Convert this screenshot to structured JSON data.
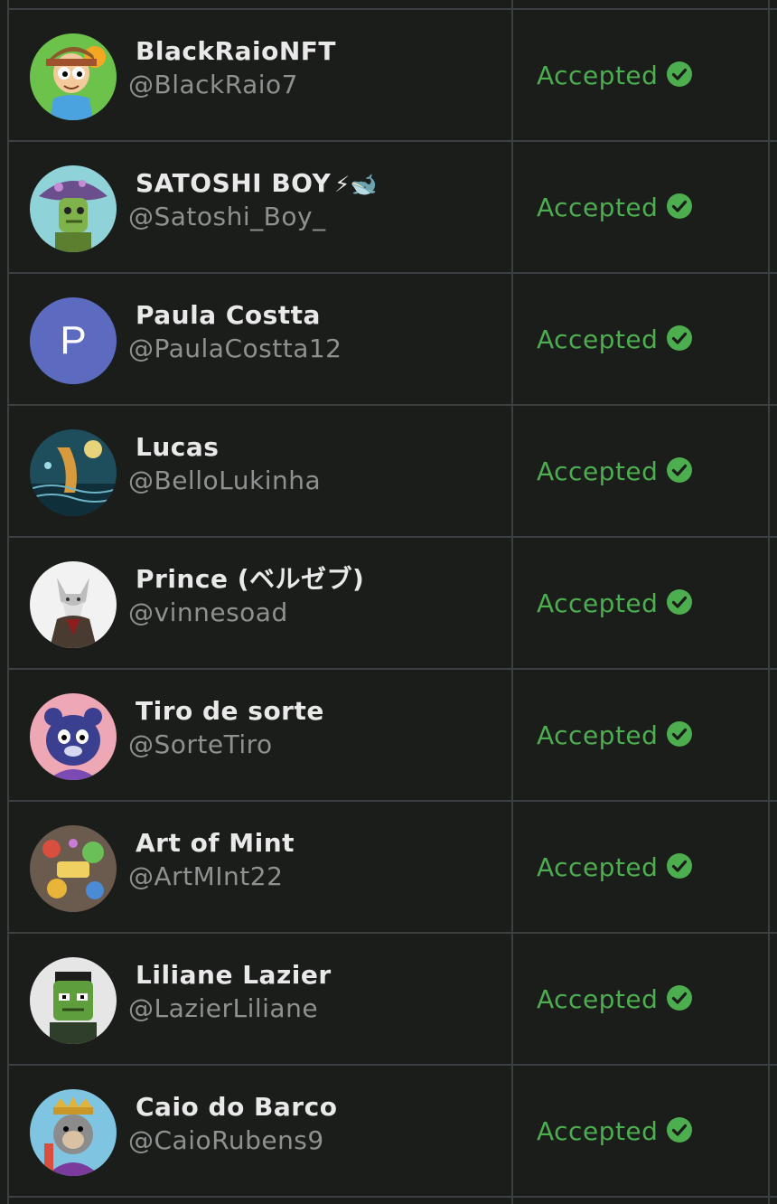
{
  "rows": [
    {
      "name": "BlackRaioNFT",
      "handle": "@BlackRaio7",
      "status": "Accepted",
      "avatar": "cartoon-boy-avatar"
    },
    {
      "name": "SATOSHI BOY",
      "name_suffix": "⚡🐋",
      "handle": "@Satoshi_Boy_",
      "status": "Accepted",
      "avatar": "mushroom-creature-avatar"
    },
    {
      "name": "Paula Costta",
      "handle": "@PaulaCostta12",
      "status": "Accepted",
      "avatar": "letter-avatar",
      "initial": "P"
    },
    {
      "name": "Lucas",
      "handle": "@BelloLukinha",
      "status": "Accepted",
      "avatar": "ocean-art-avatar"
    },
    {
      "name": "Prince (ベルゼブ)",
      "handle": "@vinnesoad",
      "status": "Accepted",
      "avatar": "wolf-avatar"
    },
    {
      "name": "Tiro de sorte",
      "handle": "@SorteTiro",
      "status": "Accepted",
      "avatar": "purple-bear-avatar"
    },
    {
      "name": "Art of Mint",
      "handle": "@ArtMInt22",
      "status": "Accepted",
      "avatar": "art-collage-avatar"
    },
    {
      "name": "Liliane Lazier",
      "handle": "@LazierLiliane",
      "status": "Accepted",
      "avatar": "zombie-avatar"
    },
    {
      "name": "Caio do Barco",
      "handle": "@CaioRubens9",
      "status": "Accepted",
      "avatar": "king-ape-avatar"
    }
  ],
  "colors": {
    "background": "#1a1d19",
    "grid": "#3a3f42",
    "name": "#e9e9e9",
    "handle": "#8e9190",
    "accepted": "#4cae4f",
    "initial_avatar": "#5c6bc0"
  },
  "icons": {
    "status": "check-circle-icon"
  }
}
